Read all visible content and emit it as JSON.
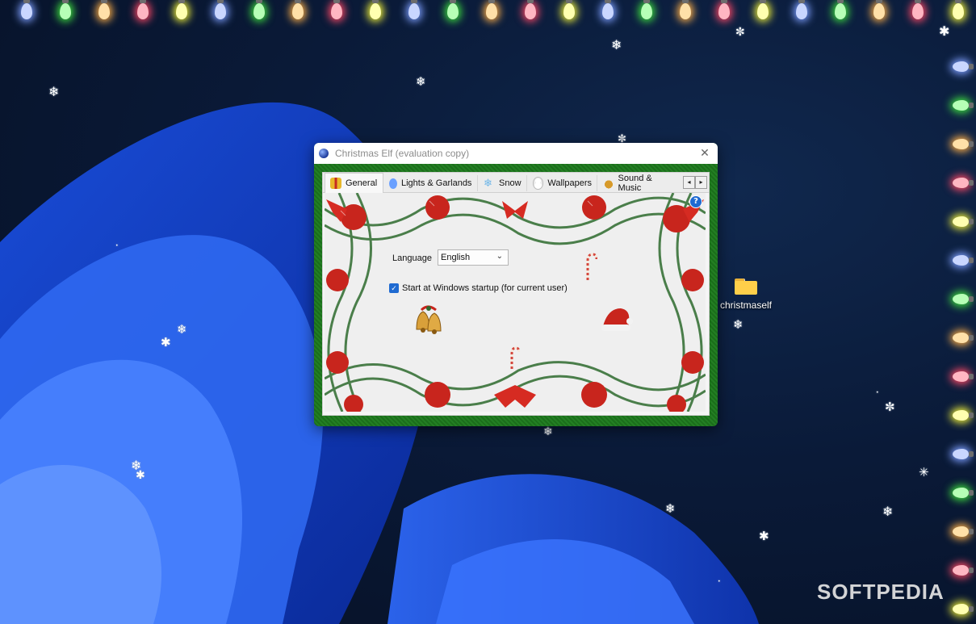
{
  "window": {
    "title": "Christmas Elf (evaluation copy)",
    "close_glyph": "✕"
  },
  "tabs": [
    {
      "label": "General",
      "icon": "gift-icon",
      "active": true
    },
    {
      "label": "Lights & Garlands",
      "icon": "bulb-icon"
    },
    {
      "label": "Snow",
      "icon": "snowflake-icon"
    },
    {
      "label": "Wallpapers",
      "icon": "snowman-icon"
    },
    {
      "label": "Sound & Music",
      "icon": "bells-icon"
    }
  ],
  "tab_scroll": {
    "left": "◂",
    "right": "▸"
  },
  "general": {
    "help_glyph": "?",
    "language_label": "Language",
    "language_value": "English",
    "startup_label": "Start at Windows startup (for current user)",
    "startup_checked": true,
    "check_glyph": "✓"
  },
  "desktop": {
    "icon_label": "christmaself"
  },
  "watermark": "SOFTPEDIA",
  "colors": {
    "frame_green": "#1c7a1c",
    "accent_blue": "#1f6ad1",
    "ornament_red": "#c8251d",
    "pine_green": "#2e6b2e"
  }
}
